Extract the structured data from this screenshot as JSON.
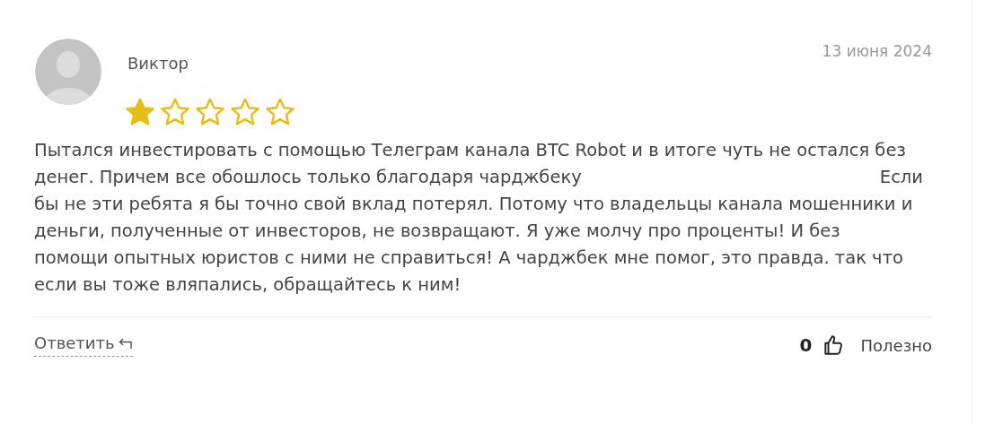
{
  "review": {
    "author": "Виктор",
    "date": "13 июня 2024",
    "stars": 1,
    "lines": [
      [
        "Пытался инвестировать с помощью Телеграм канала BTC Robot и в итоге чуть не остался без"
      ],
      [
        "денег. Причем все обошлось только благодаря чарджбеку",
        "Если"
      ],
      [
        "бы не эти ребята я бы точно свой вклад потерял. Потому что владельцы канала мошенники и"
      ],
      [
        "деньги, полученные от инвесторов, не возвращают. Я уже молчу про проценты! И без"
      ],
      [
        "помощи опытных юристов с ними не справиться! А чарджбек мне помог, это правда. так что"
      ],
      [
        "если вы тоже вляпались, обращайтесь к ним!"
      ]
    ]
  },
  "footer": {
    "reply": "Ответить",
    "likes": "0",
    "helpful": "Полезно"
  }
}
